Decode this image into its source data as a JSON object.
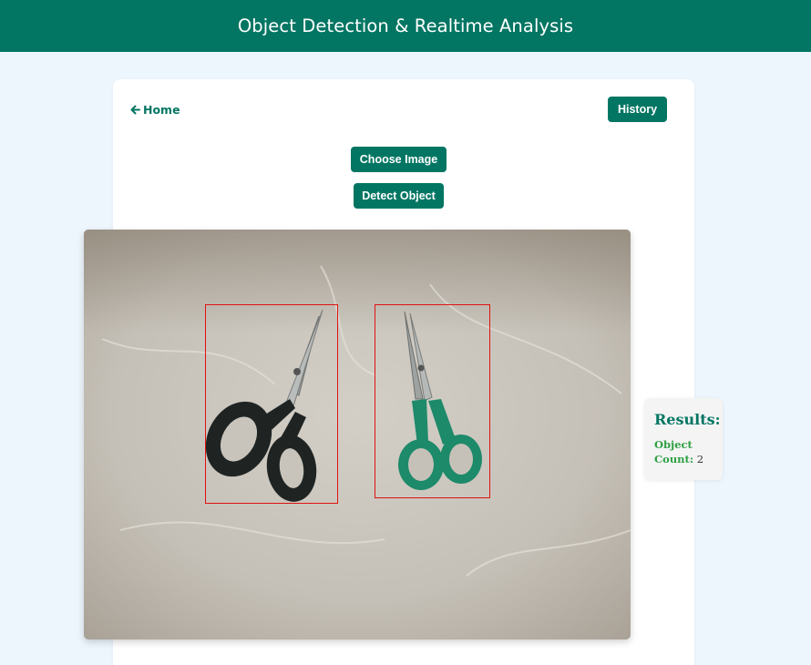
{
  "header": {
    "title": "Object Detection & Realtime Analysis"
  },
  "nav": {
    "home_label": "Home",
    "home_icon": "arrow-left-icon",
    "history_label": "History"
  },
  "actions": {
    "choose_label": "Choose Image",
    "detect_label": "Detect Object"
  },
  "image": {
    "description_icon": "scissors-photo",
    "detections": 2
  },
  "results": {
    "title": "Results:",
    "count_label": "Object Count:",
    "count_value": "2"
  },
  "colors": {
    "primary": "#037663",
    "background": "#eef6fd",
    "bbox": "#e01212",
    "count_label": "#2ea043"
  }
}
